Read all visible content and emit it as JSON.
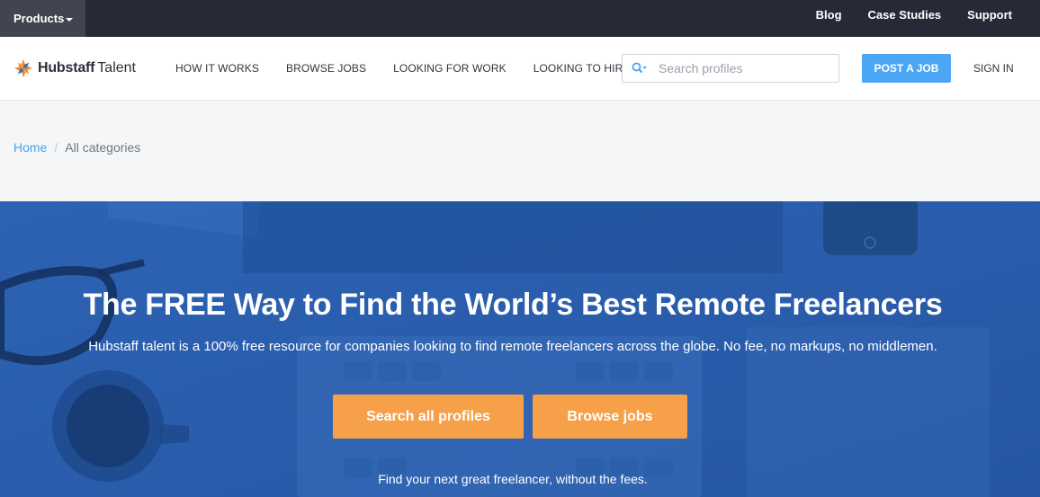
{
  "topbar": {
    "products_label": "Products",
    "links": [
      "Blog",
      "Case Studies",
      "Support"
    ],
    "colors": {
      "background": "#262a37",
      "products_bg": "#41454f"
    }
  },
  "nav": {
    "brand": "Hubstaff",
    "brand_sub": "Talent",
    "links": [
      "HOW IT WORKS",
      "BROWSE JOBS",
      "LOOKING FOR WORK",
      "LOOKING TO HIRE"
    ],
    "search": {
      "placeholder": "Search profiles",
      "value": "",
      "icon": "search-icon"
    },
    "post_job_label": "POST A JOB",
    "sign_in_label": "SIGN IN",
    "colors": {
      "accent": "#4ba6f5",
      "logo_orange": "#f7a04a"
    }
  },
  "breadcrumb": {
    "home": "Home",
    "separator": "/",
    "current": "All categories"
  },
  "hero": {
    "title": "The FREE Way to Find the World’s Best Remote Freelancers",
    "subtitle": "Hubstaff talent is a 100% free resource for companies looking to find remote freelancers across the globe. No fee, no markups, no middlemen.",
    "buttons": {
      "search": "Search all profiles",
      "browse": "Browse jobs"
    },
    "footnote": "Find your next great freelancer, without the fees.",
    "colors": {
      "overlay": "#2a5cab",
      "button": "#f7a04a"
    }
  }
}
